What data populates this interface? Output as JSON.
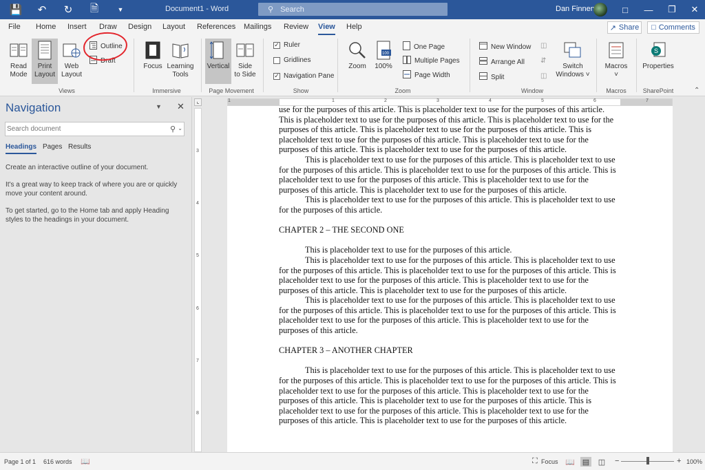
{
  "titlebar": {
    "doc_title": "Document1  -  Word",
    "search_placeholder": "Search",
    "user_name": "Dan Finnen"
  },
  "menu": {
    "tabs": [
      "File",
      "Home",
      "Insert",
      "Draw",
      "Design",
      "Layout",
      "References",
      "Mailings",
      "Review",
      "View",
      "Help"
    ],
    "active_tab": "View",
    "share_label": "Share",
    "comments_label": "Comments"
  },
  "ribbon": {
    "views": {
      "read_mode": [
        "Read",
        "Mode"
      ],
      "print_layout": [
        "Print",
        "Layout"
      ],
      "web_layout": [
        "Web",
        "Layout"
      ],
      "outline": "Outline",
      "draft": "Draft",
      "group": "Views"
    },
    "immersive": {
      "focus": "Focus",
      "learning_tools": [
        "Learning",
        "Tools"
      ],
      "group": "Immersive"
    },
    "page_movement": {
      "vertical": "Vertical",
      "side_to_side": [
        "Side",
        "to Side"
      ],
      "group": "Page Movement"
    },
    "show": {
      "ruler": "Ruler",
      "gridlines": "Gridlines",
      "navigation_pane": "Navigation Pane",
      "ruler_checked": true,
      "gridlines_checked": false,
      "navigation_pane_checked": true,
      "group": "Show"
    },
    "zoom": {
      "zoom": "Zoom",
      "hundred": "100%",
      "one_page": "One Page",
      "multiple_pages": "Multiple Pages",
      "page_width": "Page Width",
      "group": "Zoom"
    },
    "window": {
      "new_window": "New Window",
      "arrange_all": "Arrange All",
      "split": "Split",
      "switch_windows": [
        "Switch",
        "Windows ˅"
      ],
      "group": "Window"
    },
    "macros": {
      "macros": "Macros",
      "macros_dd": "˅",
      "group": "Macros"
    },
    "sharepoint": {
      "properties": "Properties",
      "group": "SharePoint"
    }
  },
  "navigation": {
    "title": "Navigation",
    "search_placeholder": "Search document",
    "tabs": [
      "Headings",
      "Pages",
      "Results"
    ],
    "active_tab": "Headings",
    "help_1": "Create an interactive outline of your document.",
    "help_2": "It's a great way to keep track of where you are or quickly move your content around.",
    "help_3": "To get started, go to the Home tab and apply Heading styles to the headings in your document."
  },
  "ruler": {
    "h_numbers": [
      "1",
      "1",
      "2",
      "3",
      "4",
      "5",
      "6",
      "7"
    ],
    "v_numbers": [
      "3",
      "4",
      "5",
      "6",
      "7",
      "8"
    ]
  },
  "document": {
    "blocks": [
      {
        "type": "p",
        "indent": false,
        "text": "use for the purposes of this article. This is placeholder text to use for the purposes of this article. This is placeholder text to use for the purposes of this article. This is placeholder text to use for the purposes of this article. This is placeholder text to use for the purposes of this article. This is placeholder text to use for the purposes of this article. This is placeholder text to use for the purposes of this article. This is placeholder text to use for the purposes of this article."
      },
      {
        "type": "p",
        "indent": true,
        "text": "This is placeholder text to use for the purposes of this article. This is placeholder text to use for the purposes of this article. This is placeholder text to use for the purposes of this article. This is placeholder text to use for the purposes of this article. This is placeholder text to use for the purposes of this article. This is placeholder text to use for the purposes of this article."
      },
      {
        "type": "p",
        "indent": true,
        "text": "This is placeholder text to use for the purposes of this article. This is placeholder text to use for the purposes of this article."
      },
      {
        "type": "chapter",
        "text": "CHAPTER 2 – THE SECOND ONE"
      },
      {
        "type": "p",
        "indent": true,
        "text": "This is placeholder text to use for the purposes of this article."
      },
      {
        "type": "p",
        "indent": true,
        "text": "This is placeholder text to use for the purposes of this article. This is placeholder text to use for the purposes of this article. This is placeholder text to use for the purposes of this article. This is placeholder text to use for the purposes of this article. This is placeholder text to use for the purposes of this article. This is placeholder text to use for the purposes of this article."
      },
      {
        "type": "p",
        "indent": true,
        "text": "This is placeholder text to use for the purposes of this article. This is placeholder text to use for the purposes of this article. This is placeholder text to use for the purposes of this article. This is placeholder text to use for the purposes of this article. This is placeholder text to use for the purposes of this article."
      },
      {
        "type": "chapter",
        "text": "CHAPTER 3 – ANOTHER CHAPTER"
      },
      {
        "type": "p",
        "indent": true,
        "text": "This is placeholder text to use for the purposes of this article. This is placeholder text to use for the purposes of this article. This is placeholder text to use for the purposes of this article. This is placeholder text to use for the purposes of this article. This is placeholder text to use for the purposes of this article. This is placeholder text to use for the purposes of this article. This is placeholder text to use for the purposes of this article. This is placeholder text to use for the purposes of this article. This is placeholder text to use for the purposes of this article."
      }
    ]
  },
  "status": {
    "page": "Page 1 of 1",
    "words": "616 words",
    "focus": "Focus",
    "zoom": "100%",
    "zoom_minus": "−",
    "zoom_plus": "+",
    "zoom_fraction": 0.5
  },
  "colors": {
    "accent": "#2b579a",
    "annotation": "#e3242b"
  }
}
